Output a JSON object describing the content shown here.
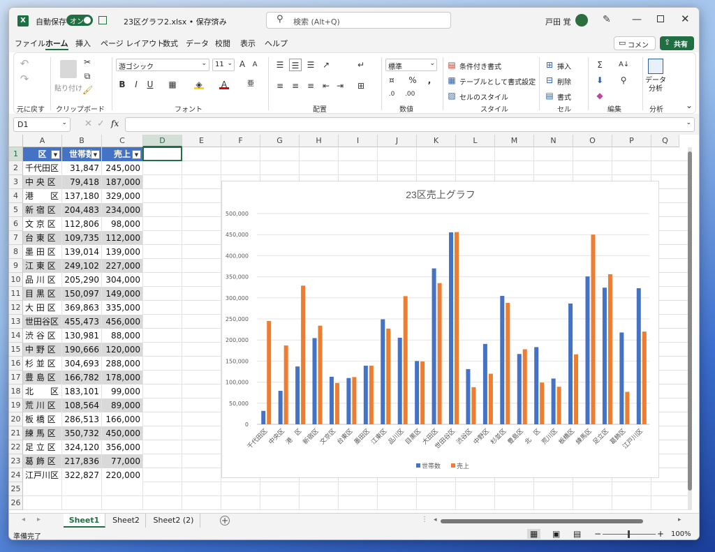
{
  "window": {
    "app_icon": "excel-icon",
    "autosave_label": "自動保存",
    "autosave_state": "オン",
    "file_title": "23区グラフ2.xlsx • 保存済み",
    "title_arrow": "⌄",
    "search_placeholder": "検索 (Alt+Q)",
    "user_name": "戸田 覚"
  },
  "tabs": [
    "ファイル",
    "ホーム",
    "挿入",
    "ページ レイアウト",
    "数式",
    "データ",
    "校閲",
    "表示",
    "ヘルプ"
  ],
  "active_tab": "ホーム",
  "header_buttons": {
    "comment": "コメント",
    "share": "共有"
  },
  "ribbon": {
    "undo_group": "元に戻す",
    "clipboard": {
      "label": "クリップボード",
      "paste": "貼り付け"
    },
    "font": {
      "label": "フォント",
      "name": "游ゴシック",
      "size": "11"
    },
    "alignment": {
      "label": "配置"
    },
    "number": {
      "label": "数値",
      "format": "標準"
    },
    "styles": {
      "label": "スタイル",
      "items": [
        "条件付き書式",
        "テーブルとして書式設定",
        "セルのスタイル"
      ]
    },
    "cells": {
      "label": "セル",
      "items": [
        "挿入",
        "削除",
        "書式"
      ]
    },
    "editing": {
      "label": "編集"
    },
    "analysis": {
      "label": "分析",
      "button": "データ分析"
    }
  },
  "namebox": "D1",
  "columns": [
    "A",
    "B",
    "C",
    "D",
    "E",
    "F",
    "G",
    "H",
    "I",
    "J",
    "K",
    "L",
    "M",
    "N",
    "O",
    "P",
    "Q"
  ],
  "rows": [
    "1",
    "2",
    "3",
    "4",
    "5",
    "6",
    "7",
    "8",
    "9",
    "10",
    "11",
    "12",
    "13",
    "14",
    "15",
    "16",
    "17",
    "18",
    "19",
    "20",
    "21",
    "22",
    "23",
    "24",
    "25",
    "26"
  ],
  "table": {
    "headers": [
      "区",
      "世帯数",
      "売上"
    ],
    "data": [
      [
        "千代田区",
        "31,847",
        "245,000"
      ],
      [
        "中 央 区",
        "79,418",
        "187,000"
      ],
      [
        "港　　区",
        "137,180",
        "329,000"
      ],
      [
        "新 宿 区",
        "204,483",
        "234,000"
      ],
      [
        "文 京 区",
        "112,806",
        "98,000"
      ],
      [
        "台 東 区",
        "109,735",
        "112,000"
      ],
      [
        "墨 田 区",
        "139,014",
        "139,000"
      ],
      [
        "江 東 区",
        "249,102",
        "227,000"
      ],
      [
        "品 川 区",
        "205,290",
        "304,000"
      ],
      [
        "目 黒 区",
        "150,097",
        "149,000"
      ],
      [
        "大 田 区",
        "369,863",
        "335,000"
      ],
      [
        "世田谷区",
        "455,473",
        "456,000"
      ],
      [
        "渋 谷 区",
        "130,981",
        "88,000"
      ],
      [
        "中 野 区",
        "190,666",
        "120,000"
      ],
      [
        "杉 並 区",
        "304,693",
        "288,000"
      ],
      [
        "豊 島 区",
        "166,782",
        "178,000"
      ],
      [
        "北　　区",
        "183,101",
        "99,000"
      ],
      [
        "荒 川 区",
        "108,564",
        "89,000"
      ],
      [
        "板 橋 区",
        "286,513",
        "166,000"
      ],
      [
        "練 馬 区",
        "350,732",
        "450,000"
      ],
      [
        "足 立 区",
        "324,120",
        "356,000"
      ],
      [
        "葛 飾 区",
        "217,836",
        "77,000"
      ],
      [
        "江戸川区",
        "322,827",
        "220,000"
      ]
    ]
  },
  "sheets": [
    "Sheet1",
    "Sheet2",
    "Sheet2 (2)"
  ],
  "active_sheet": "Sheet1",
  "status": {
    "ready": "準備完了",
    "zoom": "100%"
  },
  "chart_data": {
    "type": "bar",
    "title": "23区売上グラフ",
    "categories": [
      "千代田区",
      "中央区",
      "港　区",
      "新宿区",
      "文京区",
      "台東区",
      "墨田区",
      "江東区",
      "品川区",
      "目黒区",
      "大田区",
      "世田谷区",
      "渋谷区",
      "中野区",
      "杉並区",
      "豊島区",
      "北　区",
      "荒川区",
      "板橋区",
      "練馬区",
      "足立区",
      "葛飾区",
      "江戸川区"
    ],
    "series": [
      {
        "name": "世帯数",
        "color": "#4472c4",
        "values": [
          31847,
          79418,
          137180,
          204483,
          112806,
          109735,
          139014,
          249102,
          205290,
          150097,
          369863,
          455473,
          130981,
          190666,
          304693,
          166782,
          183101,
          108564,
          286513,
          350732,
          324120,
          217836,
          322827
        ]
      },
      {
        "name": "売上",
        "color": "#ed7d31",
        "values": [
          245000,
          187000,
          329000,
          234000,
          98000,
          112000,
          139000,
          227000,
          304000,
          149000,
          335000,
          456000,
          88000,
          120000,
          288000,
          178000,
          99000,
          89000,
          166000,
          450000,
          356000,
          77000,
          220000
        ]
      }
    ],
    "ylim": [
      0,
      500000
    ],
    "yticks": [
      "0",
      "50,000",
      "100,000",
      "150,000",
      "200,000",
      "250,000",
      "300,000",
      "350,000",
      "400,000",
      "450,000",
      "500,000"
    ],
    "grid": true,
    "legend": "bottom"
  }
}
